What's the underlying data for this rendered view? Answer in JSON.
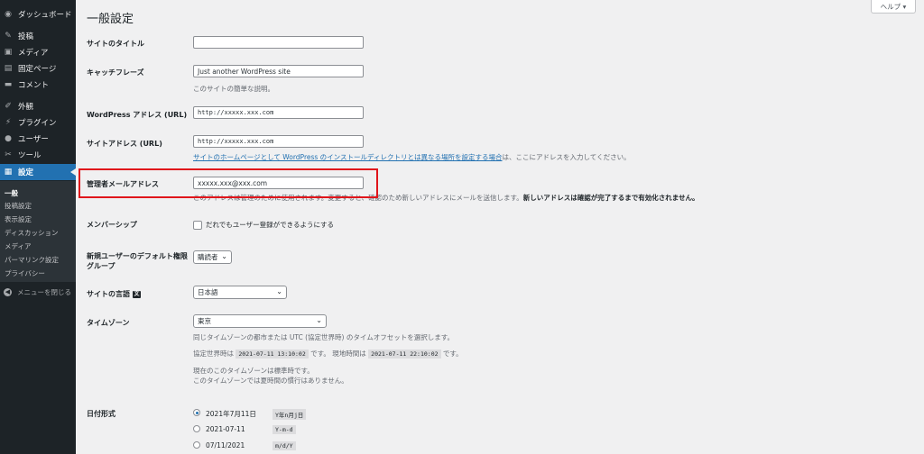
{
  "sidebar": {
    "items": [
      {
        "label": "ダッシュボード",
        "icon": "dashboard-icon"
      },
      {
        "label": "投稿",
        "icon": "pin-icon"
      },
      {
        "label": "メディア",
        "icon": "media-icon"
      },
      {
        "label": "固定ページ",
        "icon": "page-icon"
      },
      {
        "label": "コメント",
        "icon": "comment-icon"
      },
      {
        "label": "外観",
        "icon": "brush-icon"
      },
      {
        "label": "プラグイン",
        "icon": "plugin-icon"
      },
      {
        "label": "ユーザー",
        "icon": "user-icon"
      },
      {
        "label": "ツール",
        "icon": "wrench-icon"
      },
      {
        "label": "設定",
        "icon": "settings-icon"
      }
    ],
    "submenu": [
      "一般",
      "投稿設定",
      "表示設定",
      "ディスカッション",
      "メディア",
      "パーマリンク設定",
      "プライバシー"
    ],
    "collapse_label": "メニューを閉じる"
  },
  "header": {
    "title": "一般設定",
    "help_label": "ヘルプ ▾"
  },
  "form": {
    "site_title": {
      "label": "サイトのタイトル",
      "value": ""
    },
    "tagline": {
      "label": "キャッチフレーズ",
      "value": "Just another WordPress site",
      "desc": "このサイトの簡単な説明。"
    },
    "wp_address": {
      "label": "WordPress アドレス (URL)",
      "value": "http://xxxxx.xxx.com"
    },
    "site_address": {
      "label": "サイトアドレス (URL)",
      "value": "http://xxxxx.xxx.com",
      "desc_link": "サイトのホームページとして WordPress のインストールディレクトリとは異なる場所を設定する場合",
      "desc_tail": "は、ここにアドレスを入力してください。"
    },
    "admin_email": {
      "label": "管理者メールアドレス",
      "value": "xxxxx.xxx@xxx.com",
      "desc": "このアドレスは管理のために使用されます。変更すると、確認のため新しいアドレスにメールを送信します。",
      "desc_bold": "新しいアドレスは確認が完了するまで有効化されません。"
    },
    "membership": {
      "label": "メンバーシップ",
      "checkbox": "だれでもユーザー登録ができるようにする"
    },
    "default_role": {
      "label": "新規ユーザーのデフォルト権限グループ",
      "value": "購読者"
    },
    "language": {
      "label": "サイトの言語",
      "value": "日本語"
    },
    "timezone": {
      "label": "タイムゾーン",
      "value": "東京",
      "desc": "同じタイムゾーンの都市または UTC (協定世界時) のタイムオフセットを選択します。",
      "utc_label": "協定世界時は",
      "utc_time": "2021-07-11 13:10:02",
      "utc_suffix": "です。",
      "local_label": "現地時間は",
      "local_time": "2021-07-11 22:10:02",
      "local_suffix": "です。",
      "std_line1": "現在のこのタイムゾーンは標準時です。",
      "std_line2": "このタイムゾーンでは夏時間の慣行はありません。"
    },
    "date_format": {
      "label": "日付形式",
      "options": [
        {
          "label": "2021年7月11日",
          "code": "Y年n月j日",
          "checked": true
        },
        {
          "label": "2021-07-11",
          "code": "Y-m-d",
          "checked": false
        },
        {
          "label": "07/11/2021",
          "code": "m/d/Y",
          "checked": false
        }
      ]
    }
  },
  "colors": {
    "sidebar_bg": "#1d2327",
    "active": "#2271b1",
    "highlight": "#e0151b"
  }
}
